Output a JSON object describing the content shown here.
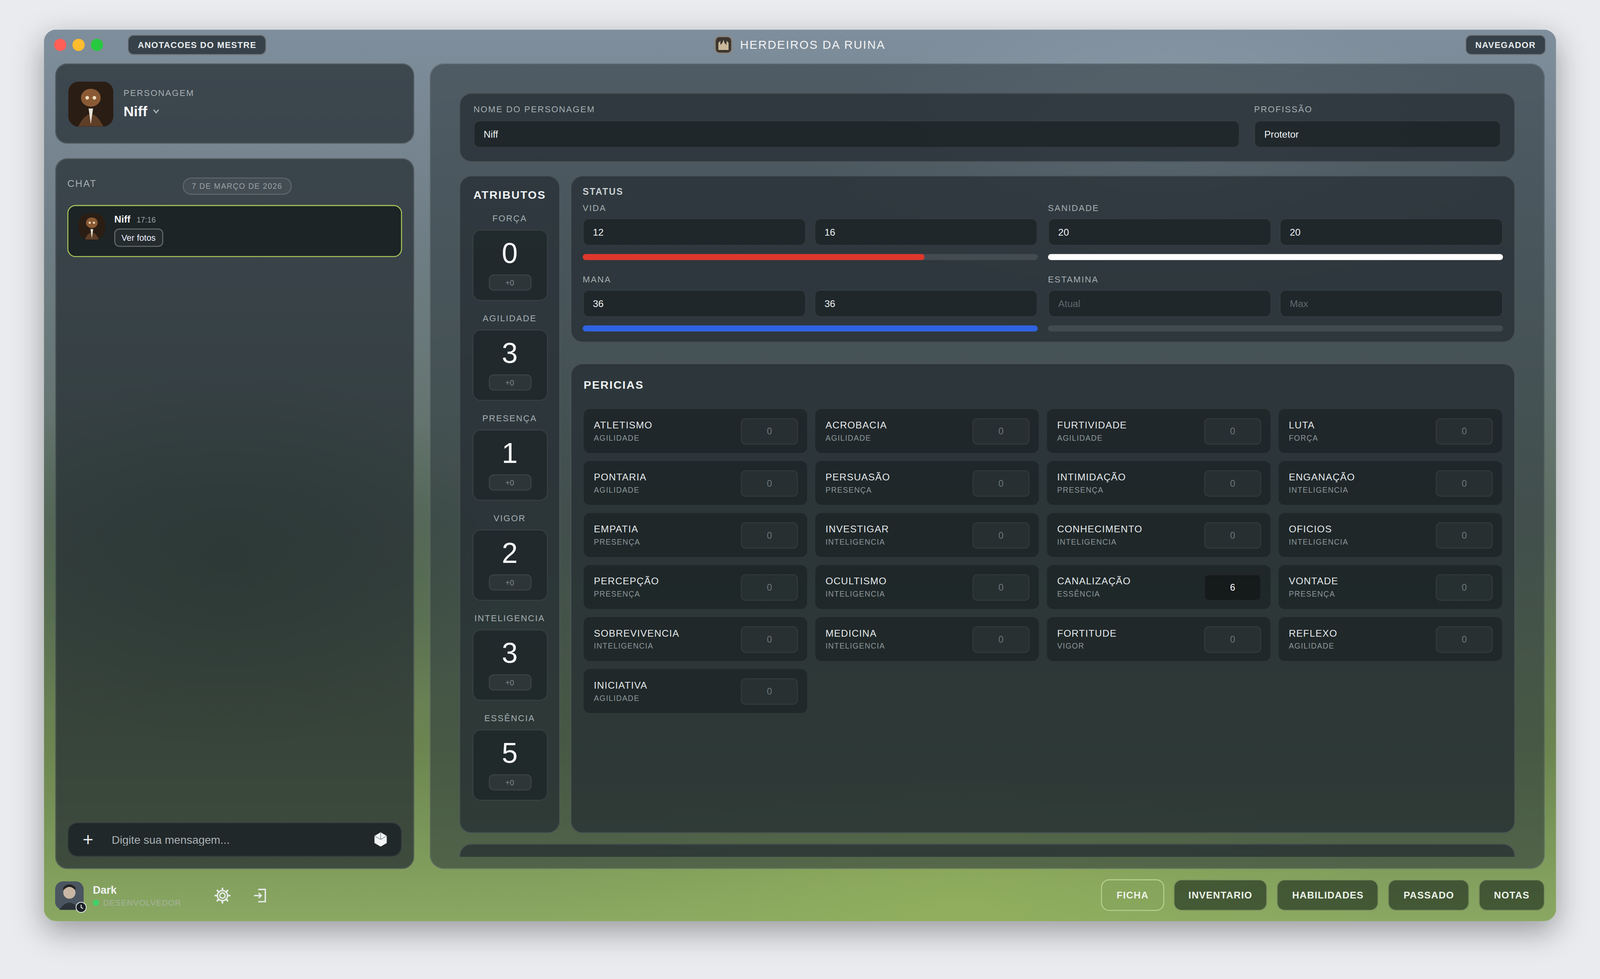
{
  "window": {
    "title": "HERDEIROS DA RUINA"
  },
  "toolbar": {
    "left_button": "ANOTACOES DO MESTRE",
    "right_button": "NAVEGADOR"
  },
  "character": {
    "label": "PERSONAGEM",
    "name": "Niff"
  },
  "chat": {
    "title": "CHAT",
    "date": "7 DE MARÇO DE 2026",
    "messages": [
      {
        "author": "Niff",
        "time": "17:16",
        "button": "Ver fotos",
        "selected": true
      }
    ],
    "input": {
      "add": "+",
      "placeholder": "Digite sua mensagem..."
    }
  },
  "user": {
    "name": "Dark",
    "role": "DESENVOLVEDOR",
    "online": true
  },
  "tabs": [
    {
      "label": "FICHA",
      "selected": true
    },
    {
      "label": "INVENTARIO",
      "selected": false
    },
    {
      "label": "HABILIDADES",
      "selected": false
    },
    {
      "label": "PASSADO",
      "selected": false
    },
    {
      "label": "NOTAS",
      "selected": false
    }
  ],
  "sheet": {
    "name_label": "NOME DO PERSONAGEM",
    "name": "Niff",
    "profession_label": "PROFISSÃO",
    "profession": "Protetor"
  },
  "attributes": {
    "title": "ATRIBUTOS",
    "items": [
      {
        "name": "FORÇA",
        "value": "0",
        "modifier": "+0"
      },
      {
        "name": "AGILIDADE",
        "value": "3",
        "modifier": "+0"
      },
      {
        "name": "PRESENÇA",
        "value": "1",
        "modifier": "+0"
      },
      {
        "name": "VIGOR",
        "value": "2",
        "modifier": "+0"
      },
      {
        "name": "INTELIGENCIA",
        "value": "3",
        "modifier": "+0"
      },
      {
        "name": "ESSÊNCIA",
        "value": "5",
        "modifier": "+0"
      }
    ]
  },
  "status": {
    "title": "STATUS",
    "groups": [
      {
        "label": "VIDA",
        "current": "12",
        "max": "16",
        "level": 0.75,
        "color": "#e0372c"
      },
      {
        "label": "SANIDADE",
        "current": "20",
        "max": "20",
        "level": 1,
        "color": "#ffffff"
      },
      {
        "label": "MANA",
        "current": "36",
        "max": "36",
        "level": 1,
        "color": "#2f63e3"
      },
      {
        "label": "ESTAMINA",
        "current_placeholder": "Atual",
        "max_placeholder": "Max",
        "level": 0,
        "color": "#8a9194"
      }
    ]
  },
  "skills": {
    "title": "PERICIAS",
    "items": [
      {
        "name": "ATLETISMO",
        "attribute": "AGILIDADE",
        "value": "0",
        "active": false
      },
      {
        "name": "ACROBACIA",
        "attribute": "AGILIDADE",
        "value": "0",
        "active": false
      },
      {
        "name": "FURTIVIDADE",
        "attribute": "AGILIDADE",
        "value": "0",
        "active": false
      },
      {
        "name": "LUTA",
        "attribute": "FORÇA",
        "value": "0",
        "active": false
      },
      {
        "name": "PONTARIA",
        "attribute": "AGILIDADE",
        "value": "0",
        "active": false
      },
      {
        "name": "PERSUASÃO",
        "attribute": "PRESENÇA",
        "value": "0",
        "active": false
      },
      {
        "name": "INTIMIDAÇÃO",
        "attribute": "PRESENÇA",
        "value": "0",
        "active": false
      },
      {
        "name": "ENGANAÇÃO",
        "attribute": "INTELIGENCIA",
        "value": "0",
        "active": false
      },
      {
        "name": "EMPATIA",
        "attribute": "PRESENÇA",
        "value": "0",
        "active": false
      },
      {
        "name": "INVESTIGAR",
        "attribute": "INTELIGENCIA",
        "value": "0",
        "active": false
      },
      {
        "name": "CONHECIMENTO",
        "attribute": "INTELIGENCIA",
        "value": "0",
        "active": false
      },
      {
        "name": "OFICIOS",
        "attribute": "INTELIGENCIA",
        "value": "0",
        "active": false
      },
      {
        "name": "PERCEPÇÃO",
        "attribute": "PRESENÇA",
        "value": "0",
        "active": false
      },
      {
        "name": "OCULTISMO",
        "attribute": "INTELIGENCIA",
        "value": "0",
        "active": false
      },
      {
        "name": "CANALIZAÇÃO",
        "attribute": "ESSÊNCIA",
        "value": "6",
        "active": true
      },
      {
        "name": "VONTADE",
        "attribute": "PRESENÇA",
        "value": "0",
        "active": false
      },
      {
        "name": "SOBREVIVENCIA",
        "attribute": "INTELIGENCIA",
        "value": "0",
        "active": false
      },
      {
        "name": "MEDICINA",
        "attribute": "INTELIGENCIA",
        "value": "0",
        "active": false
      },
      {
        "name": "FORTITUDE",
        "attribute": "VIGOR",
        "value": "0",
        "active": false
      },
      {
        "name": "REFLEXO",
        "attribute": "AGILIDADE",
        "value": "0",
        "active": false
      },
      {
        "name": "INICIATIVA",
        "attribute": "AGILIDADE",
        "value": "0",
        "active": false
      }
    ]
  }
}
